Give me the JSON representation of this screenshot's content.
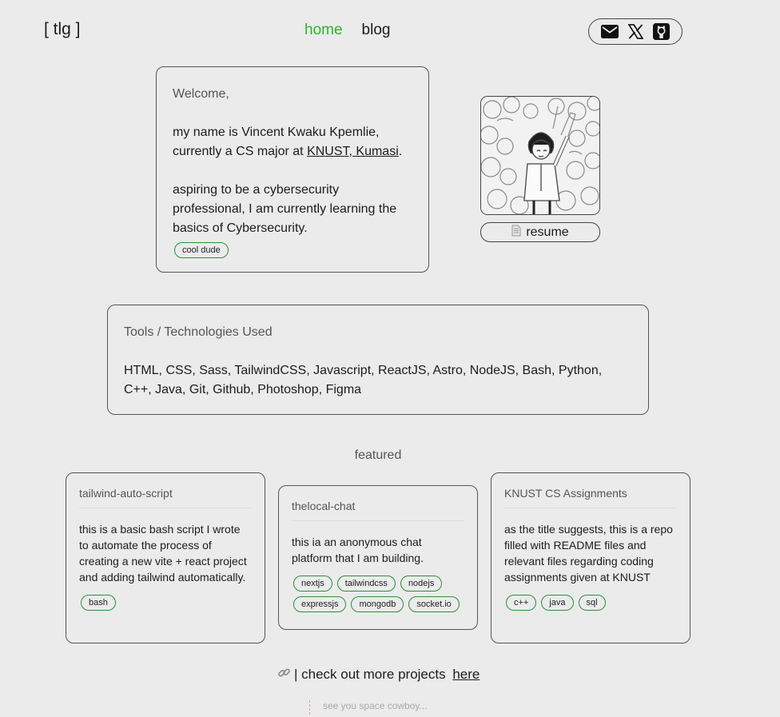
{
  "header": {
    "logo": "[ tlg ]",
    "nav": [
      {
        "label": "home",
        "active": true
      },
      {
        "label": "blog",
        "active": false
      }
    ],
    "socials": [
      {
        "icon": "mail-icon"
      },
      {
        "icon": "x-icon"
      },
      {
        "icon": "github-icon"
      }
    ]
  },
  "intro": {
    "greeting": "Welcome,",
    "line1": "my name is Vincent Kwaku Kpemlie, currently a CS major at ",
    "school_link": "KNUST, Kumasi",
    "line1_end": ".",
    "line2": "aspiring to be a cybersecurity professional, I am currently learning the basics of Cybersecurity.",
    "tag": "cool dude"
  },
  "profile": {
    "resume_label": "resume",
    "resume_icon": "document-icon"
  },
  "tools": {
    "title": "Tools / Technologies Used",
    "list": "HTML, CSS, Sass, TailwindCSS, Javascript, ReactJS, Astro, NodeJS, Bash, Python, C++, Java, Git, Github, Photoshop, Figma"
  },
  "featured": {
    "heading": "featured",
    "projects": [
      {
        "title": "tailwind-auto-script",
        "description": "this is a basic bash script I wrote to automate the process of creating a new vite + react project and adding tailwind automatically.",
        "tags": [
          "bash"
        ]
      },
      {
        "title": "thelocal-chat",
        "description": "this ia an anonymous chat platform that I am building.",
        "tags": [
          "nextjs",
          "tailwindcss",
          "nodejs",
          "expressjs",
          "mongodb",
          "socket.io"
        ]
      },
      {
        "title": "KNUST CS Assignments",
        "description": "as the title suggests, this is a repo filled with README files and relevant files regarding coding assignments given at KNUST",
        "tags": [
          "c++",
          "java",
          "sql"
        ]
      }
    ]
  },
  "more_projects": {
    "icon": "link-icon",
    "prefix": "| check out more projects ",
    "link": "here"
  },
  "footer": {
    "text": "see you space cowboy..."
  },
  "colors": {
    "background": "#ebebeb",
    "accent": "#2bb52b",
    "tag_border": "#2d8f3a"
  }
}
